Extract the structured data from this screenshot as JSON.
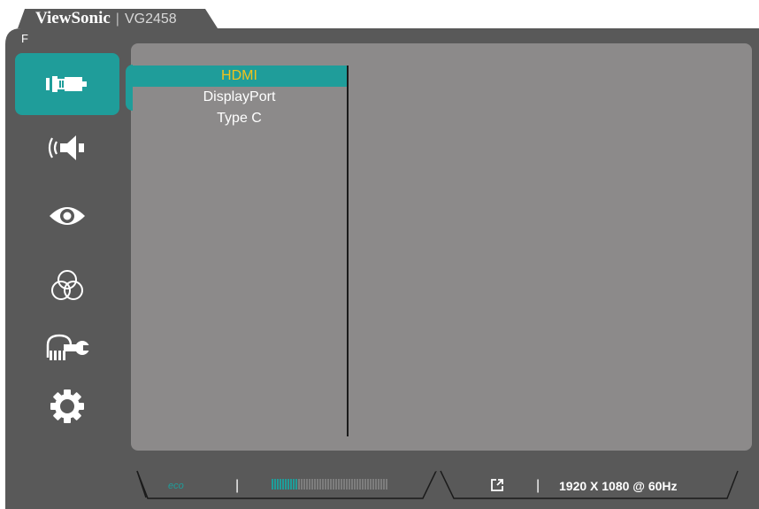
{
  "header": {
    "brand": "ViewSonic",
    "separator": "|",
    "model": "VG2458",
    "function_key": "F"
  },
  "sidebar": {
    "items": [
      {
        "name": "input-select",
        "icon": "input-plug-icon",
        "active": true
      },
      {
        "name": "audio-adjust",
        "icon": "speaker-icon",
        "active": false
      },
      {
        "name": "viewmode",
        "icon": "eye-icon",
        "active": false
      },
      {
        "name": "color-adjust",
        "icon": "rgb-circles-icon",
        "active": false
      },
      {
        "name": "manual-image-adjust",
        "icon": "hand-wrench-icon",
        "active": false
      },
      {
        "name": "setup-menu",
        "icon": "gear-icon",
        "active": false
      }
    ]
  },
  "submenu": {
    "items": [
      {
        "label": "HDMI",
        "selected": true
      },
      {
        "label": "DisplayPort",
        "selected": false
      },
      {
        "label": "Type C",
        "selected": false
      }
    ]
  },
  "status_bar": {
    "eco_label": "eco",
    "separator": "|",
    "level_fraction": 0.22,
    "resolution": "1920 X 1080 @ 60Hz"
  },
  "colors": {
    "accent": "#1f9d9a",
    "selected_text": "#f3c21b",
    "frame": "#595959",
    "panel": "#8c8a8a"
  }
}
